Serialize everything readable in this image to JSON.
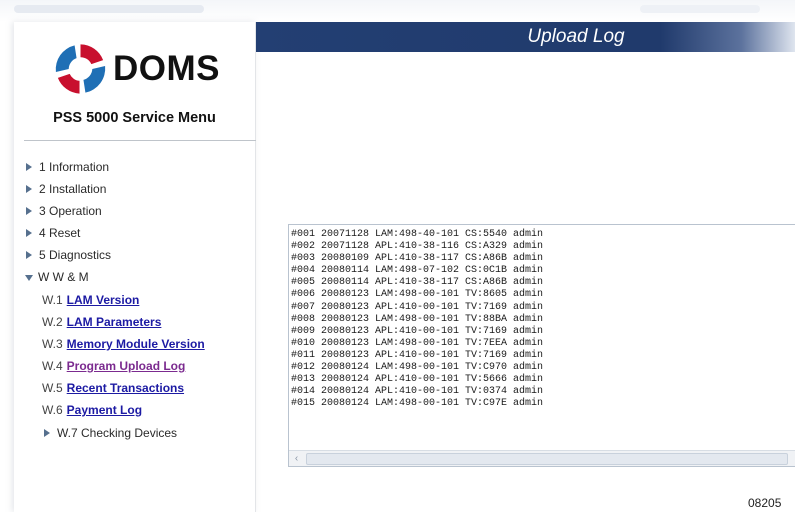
{
  "brand": {
    "logo_text": "DOMS",
    "menu_title": "PSS 5000 Service Menu",
    "colors": {
      "logo_red": "#c8102e",
      "logo_blue": "#1f6fb5",
      "header_blue": "#233f73",
      "link_blue": "#1c1aa3",
      "link_visited": "#7b2a8f"
    }
  },
  "nav": {
    "items": [
      {
        "label": "1 Information",
        "icon": "triangle-right-icon"
      },
      {
        "label": "2 Installation",
        "icon": "triangle-right-icon"
      },
      {
        "label": "3 Operation",
        "icon": "triangle-right-icon"
      },
      {
        "label": "4 Reset",
        "icon": "triangle-right-icon"
      },
      {
        "label": "5 Diagnostics",
        "icon": "triangle-right-icon"
      },
      {
        "label": "W W & M",
        "icon": "triangle-down-icon"
      }
    ],
    "subitems": [
      {
        "prefix": "W.1",
        "label": "LAM Version"
      },
      {
        "prefix": "W.2",
        "label": "LAM Parameters"
      },
      {
        "prefix": "W.3",
        "label": "Memory Module Version"
      },
      {
        "prefix": "W.4",
        "label": "Program Upload Log",
        "current": true
      },
      {
        "prefix": "W.5",
        "label": "Recent Transactions"
      },
      {
        "prefix": "W.6",
        "label": "Payment Log"
      }
    ],
    "collapsed_item": {
      "label": "W.7 Checking Devices",
      "icon": "triangle-right-icon"
    }
  },
  "header": {
    "title": "Upload Log"
  },
  "log": {
    "lines": [
      "#001 20071128 LAM:498-40-101 CS:5540 admin",
      "#002 20071128 APL:410-38-116 CS:A329 admin",
      "#003 20080109 APL:410-38-117 CS:A86B admin",
      "#004 20080114 LAM:498-07-102 CS:0C1B admin",
      "#005 20080114 APL:410-38-117 CS:A86B admin",
      "#006 20080123 LAM:498-00-101 TV:8605 admin",
      "#007 20080123 APL:410-00-101 TV:7169 admin",
      "#008 20080123 LAM:498-00-101 TV:88BA admin",
      "#009 20080123 APL:410-00-101 TV:7169 admin",
      "#010 20080123 LAM:498-00-101 TV:7EEA admin",
      "#011 20080123 APL:410-00-101 TV:7169 admin",
      "#012 20080124 LAM:498-00-101 TV:C970 admin",
      "#013 20080124 APL:410-00-101 TV:5666 admin",
      "#014 20080124 APL:410-00-101 TV:0374 admin",
      "#015 20080124 LAM:498-00-101 TV:C97E admin"
    ],
    "scroll_left_icon": "‹"
  },
  "footer": {
    "code": "08205"
  }
}
